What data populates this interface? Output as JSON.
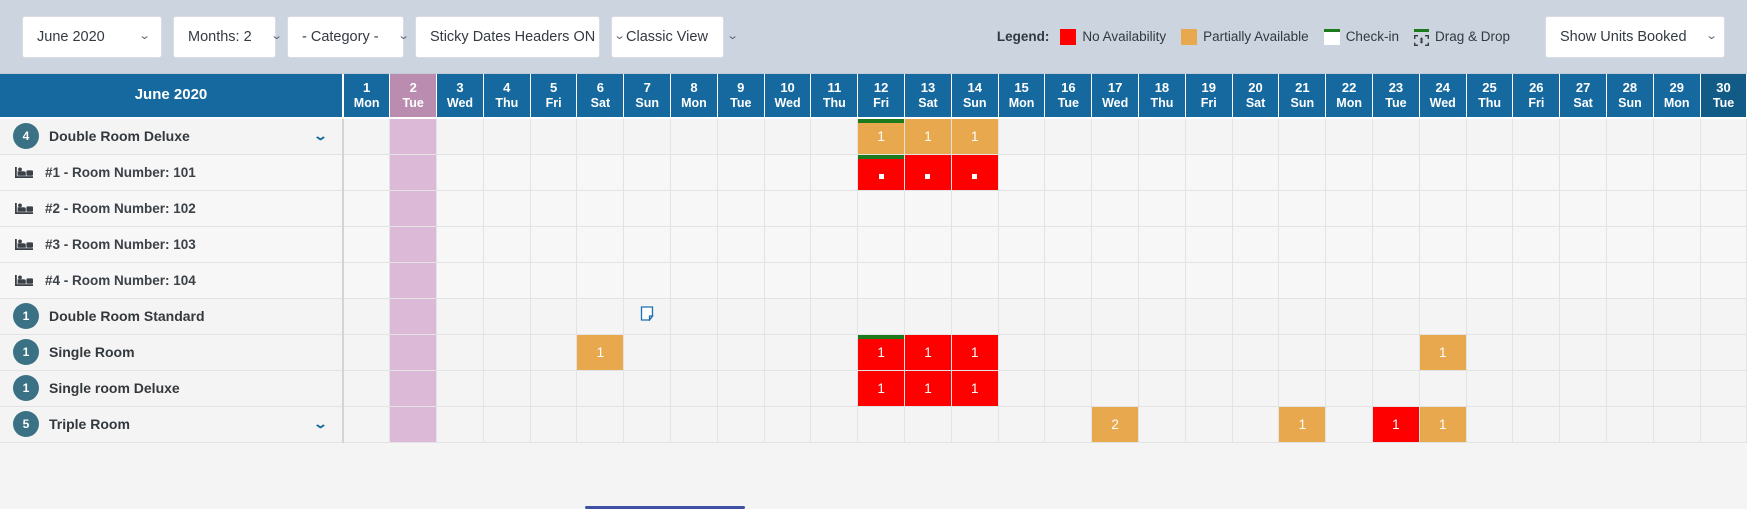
{
  "toolbar": {
    "month_select": "June 2020",
    "months_select": "Months: 2",
    "category_select": "- Category -",
    "sticky_select": "Sticky Dates Headers ON",
    "view_select": "Classic View",
    "units_select": "Show Units Booked",
    "caret": "⌄"
  },
  "legend": {
    "title": "Legend:",
    "items": [
      {
        "label": "No Availability",
        "color": "#fe0000",
        "type": "swatch"
      },
      {
        "label": "Partially Available",
        "color": "#e8a84e",
        "type": "swatch"
      },
      {
        "label": "Check-in",
        "color": "#ffffff",
        "type": "checkin"
      },
      {
        "label": "Drag & Drop",
        "color": "#1c7a1c",
        "type": "dragdrop"
      }
    ]
  },
  "calendar": {
    "month_label": "June 2020",
    "days": [
      {
        "num": "1",
        "wd": "Mon"
      },
      {
        "num": "2",
        "wd": "Tue",
        "highlight": true
      },
      {
        "num": "3",
        "wd": "Wed"
      },
      {
        "num": "4",
        "wd": "Thu"
      },
      {
        "num": "5",
        "wd": "Fri"
      },
      {
        "num": "6",
        "wd": "Sat"
      },
      {
        "num": "7",
        "wd": "Sun"
      },
      {
        "num": "8",
        "wd": "Mon"
      },
      {
        "num": "9",
        "wd": "Tue"
      },
      {
        "num": "10",
        "wd": "Wed"
      },
      {
        "num": "11",
        "wd": "Thu"
      },
      {
        "num": "12",
        "wd": "Fri"
      },
      {
        "num": "13",
        "wd": "Sat"
      },
      {
        "num": "14",
        "wd": "Sun"
      },
      {
        "num": "15",
        "wd": "Mon"
      },
      {
        "num": "16",
        "wd": "Tue"
      },
      {
        "num": "17",
        "wd": "Wed"
      },
      {
        "num": "18",
        "wd": "Thu"
      },
      {
        "num": "19",
        "wd": "Fri"
      },
      {
        "num": "20",
        "wd": "Sat"
      },
      {
        "num": "21",
        "wd": "Sun"
      },
      {
        "num": "22",
        "wd": "Mon"
      },
      {
        "num": "23",
        "wd": "Tue"
      },
      {
        "num": "24",
        "wd": "Wed"
      },
      {
        "num": "25",
        "wd": "Thu"
      },
      {
        "num": "26",
        "wd": "Fri"
      },
      {
        "num": "27",
        "wd": "Sat"
      },
      {
        "num": "28",
        "wd": "Sun"
      },
      {
        "num": "29",
        "wd": "Mon"
      },
      {
        "num": "30",
        "wd": "Tue",
        "dark": true
      }
    ],
    "rows": [
      {
        "kind": "roomtype",
        "name": "Double Room Deluxe",
        "count": "4",
        "expandable": true,
        "cells": [
          {
            "day": 12,
            "state": "orange",
            "value": "1",
            "checkin": true
          },
          {
            "day": 13,
            "state": "orange",
            "value": "1"
          },
          {
            "day": 14,
            "state": "orange",
            "value": "1"
          }
        ]
      },
      {
        "kind": "unit",
        "name": "#1 - Room Number: 101",
        "cells": [
          {
            "day": 12,
            "state": "red",
            "value": "·",
            "checkin": true
          },
          {
            "day": 13,
            "state": "red",
            "value": "·"
          },
          {
            "day": 14,
            "state": "red",
            "value": "·"
          }
        ]
      },
      {
        "kind": "unit",
        "name": "#2 - Room Number: 102",
        "cells": []
      },
      {
        "kind": "unit",
        "name": "#3 - Room Number: 103",
        "cells": []
      },
      {
        "kind": "unit",
        "name": "#4 - Room Number: 104",
        "cells": []
      },
      {
        "kind": "roomtype",
        "name": "Double Room Standard",
        "count": "1",
        "expandable": false,
        "cells": [
          {
            "day": 7,
            "state": "note"
          }
        ]
      },
      {
        "kind": "roomtype",
        "name": "Single Room",
        "count": "1",
        "expandable": false,
        "cells": [
          {
            "day": 6,
            "state": "orange",
            "value": "1"
          },
          {
            "day": 12,
            "state": "red",
            "value": "1",
            "checkin": true
          },
          {
            "day": 13,
            "state": "red",
            "value": "1"
          },
          {
            "day": 14,
            "state": "red",
            "value": "1"
          },
          {
            "day": 24,
            "state": "orange",
            "value": "1"
          }
        ]
      },
      {
        "kind": "roomtype",
        "name": "Single room Deluxe",
        "count": "1",
        "expandable": false,
        "cells": [
          {
            "day": 12,
            "state": "red",
            "value": "1"
          },
          {
            "day": 13,
            "state": "red",
            "value": "1"
          },
          {
            "day": 14,
            "state": "red",
            "value": "1"
          }
        ]
      },
      {
        "kind": "roomtype",
        "name": "Triple Room",
        "count": "5",
        "expandable": true,
        "cells": [
          {
            "day": 17,
            "state": "orange",
            "value": "2"
          },
          {
            "day": 21,
            "state": "orange",
            "value": "1"
          },
          {
            "day": 23,
            "state": "red",
            "value": "1"
          },
          {
            "day": 24,
            "state": "orange",
            "value": "1"
          }
        ]
      }
    ]
  }
}
